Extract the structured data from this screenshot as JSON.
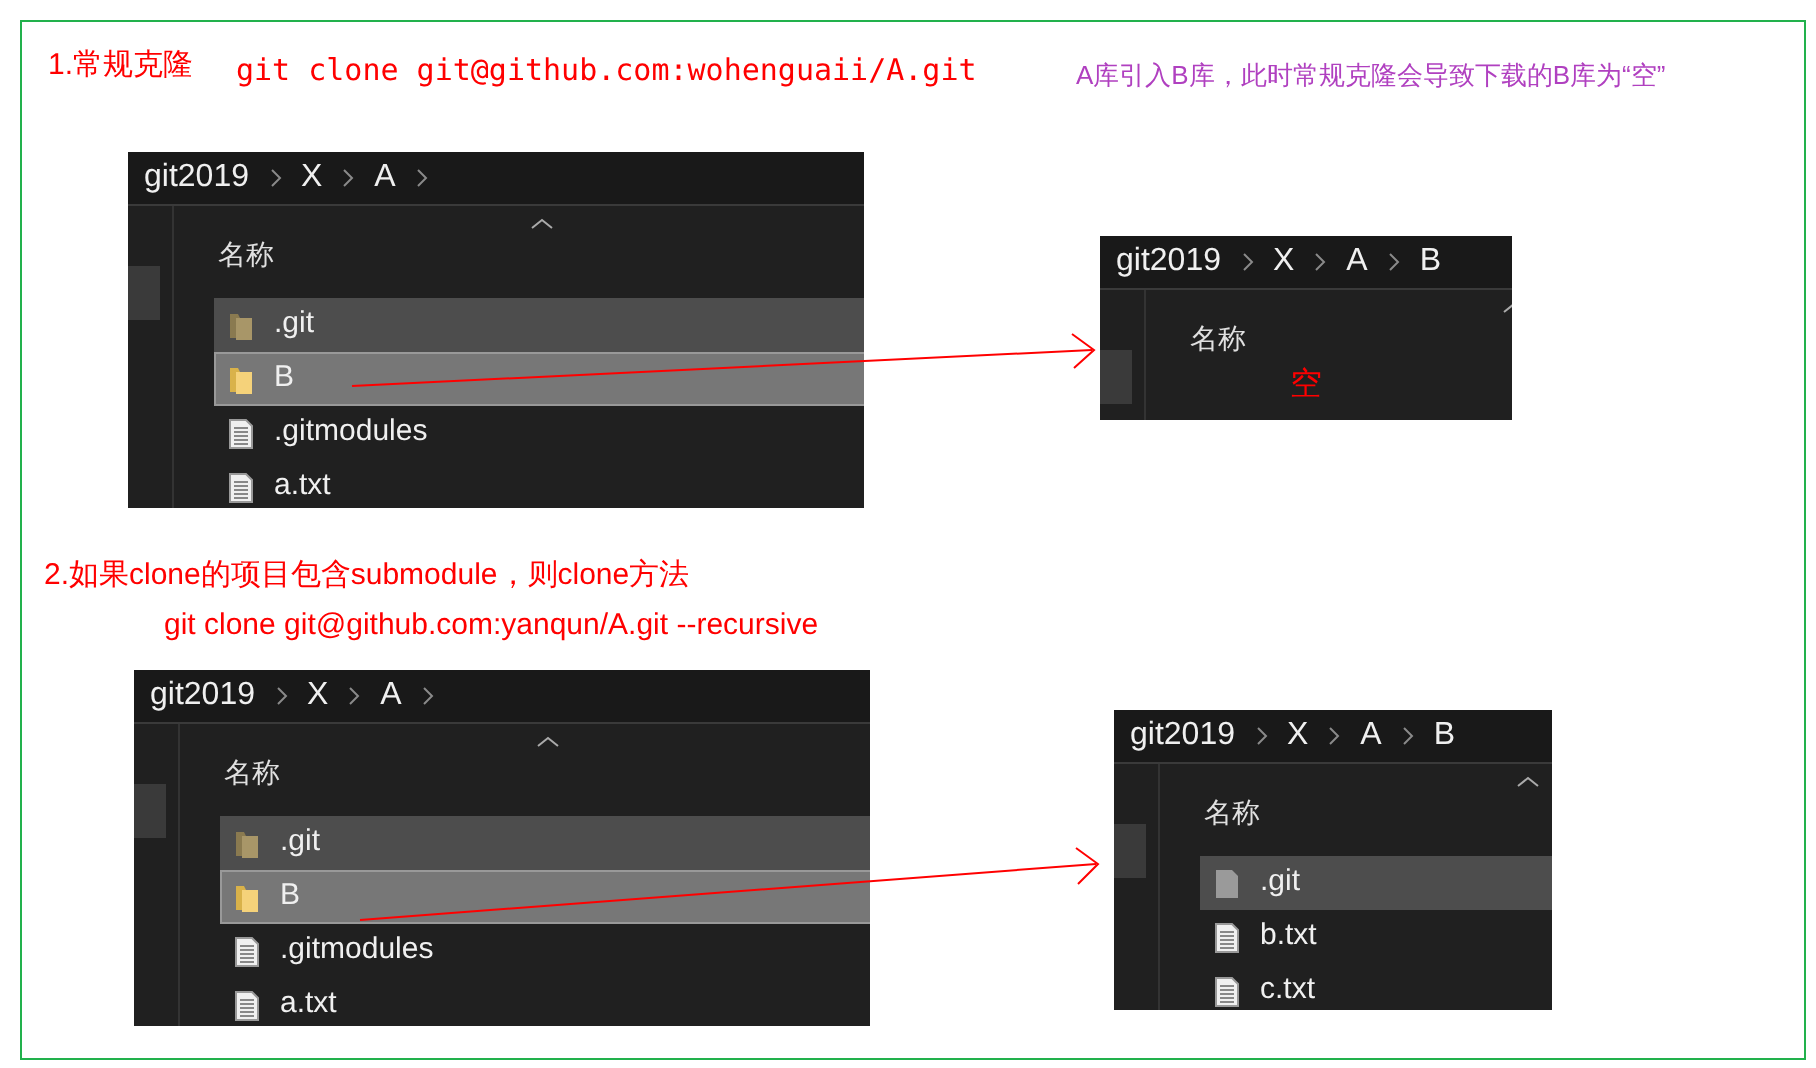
{
  "annotations": [
    {
      "kind": "heading",
      "text": "1.常规克隆"
    },
    {
      "kind": "code",
      "text": "git clone git@github.com:wohenguaii/A.git"
    },
    {
      "kind": "note",
      "text": "A库引入B库，此时常规克隆会导致下载的B库为“空”"
    },
    {
      "kind": "heading",
      "text": "2.如果clone的项目包含submodule，则clone方法"
    },
    {
      "kind": "command",
      "text": "git clone git@github.com:yanqun/A.git --recursive"
    }
  ],
  "panels": [
    {
      "breadcrumb": [
        "git2019",
        "X",
        "A"
      ],
      "trailing_chevron": true,
      "column_header": "名称",
      "rows": [
        {
          "name": ".git",
          "kind": "hidden-folder",
          "selected": false,
          "hovered": true
        },
        {
          "name": "B",
          "kind": "folder",
          "selected": true,
          "hovered": false
        },
        {
          "name": ".gitmodules",
          "kind": "file",
          "selected": false,
          "hovered": false
        },
        {
          "name": "a.txt",
          "kind": "file",
          "selected": false,
          "hovered": false
        }
      ]
    },
    {
      "breadcrumb": [
        "git2019",
        "X",
        "A",
        "B"
      ],
      "trailing_chevron": false,
      "column_header": "名称",
      "empty_note": "空"
    },
    {
      "breadcrumb": [
        "git2019",
        "X",
        "A"
      ],
      "trailing_chevron": true,
      "column_header": "名称",
      "rows": [
        {
          "name": ".git",
          "kind": "hidden-folder",
          "selected": false,
          "hovered": true
        },
        {
          "name": "B",
          "kind": "folder",
          "selected": true,
          "hovered": false
        },
        {
          "name": ".gitmodules",
          "kind": "file",
          "selected": false,
          "hovered": false
        },
        {
          "name": "a.txt",
          "kind": "file",
          "selected": false,
          "hovered": false
        }
      ]
    },
    {
      "breadcrumb": [
        "git2019",
        "X",
        "A",
        "B"
      ],
      "trailing_chevron": false,
      "column_header": "名称",
      "rows": [
        {
          "name": ".git",
          "kind": "hidden-file",
          "selected": false,
          "hovered": true
        },
        {
          "name": "b.txt",
          "kind": "file",
          "selected": false,
          "hovered": false
        },
        {
          "name": "c.txt",
          "kind": "file",
          "selected": false,
          "hovered": false
        }
      ]
    }
  ]
}
